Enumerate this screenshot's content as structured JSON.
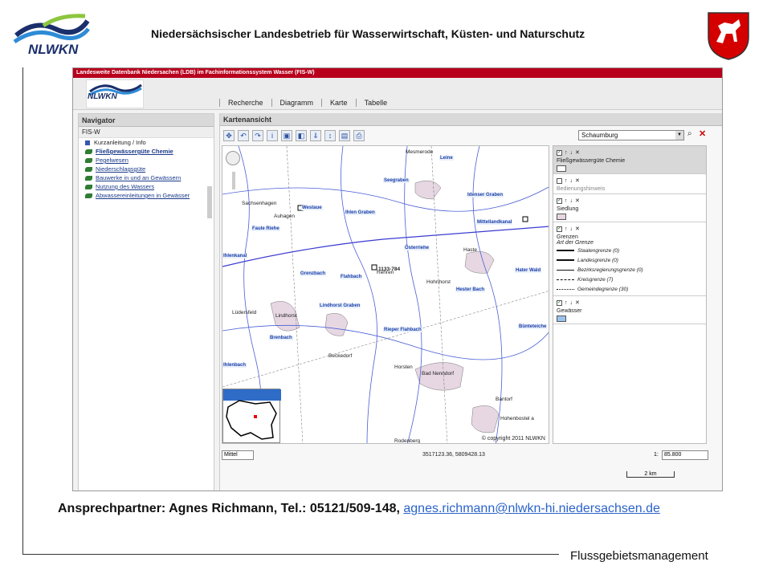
{
  "slide": {
    "title": "Niedersächsischer Landesbetrieb für Wasserwirtschaft, Küsten- und Naturschutz",
    "logo_text": "NLWKN",
    "contact_label": "Ansprechpartner: Agnes Richmann, Tel.: 05121/509-148, ",
    "contact_email": "agnes.richmann@nlwkn-hi.niedersachsen.de",
    "footer": "Flussgebietsmanagement"
  },
  "app": {
    "title_bar": "Landesweite Datenbank Niedersachen (LDB) im Fachinformationssystem Wasser (FIS-W)",
    "logo_text": "NLWKN",
    "menu": [
      "Recherche",
      "Diagramm",
      "Karte",
      "Tabelle"
    ],
    "navigator": {
      "title": "Navigator",
      "root": "FIS-W",
      "items": [
        "Kurzanleitung / Info",
        "Fließgewässergüte Chemie",
        "Pegelwesen",
        "Niederschlagsgüte",
        "Bauwerke in und an Gewässern",
        "Nutzung des Wassers",
        "Abwassereinleitungen in Gewässer"
      ]
    },
    "map_panel": {
      "title": "Kartenansicht",
      "region_select": "Schaumburg",
      "copyright": "© copyright 2011 NLWKN",
      "zoom_level": "Mittel",
      "coords": "3517123.36, 5809428.13",
      "scale_prefix": "1:",
      "scale_value": "85.800",
      "scalebar_label": "2 km"
    },
    "map_labels": {
      "places": [
        "Mesmerode",
        "Sachsenhagen",
        "Auhagen",
        "Haste",
        "Rehren",
        "Hohnhorst",
        "Lüdersfeld",
        "Lindhorst",
        "Beckedorf",
        "Horsten",
        "Bad Nenndorf",
        "Bantorf",
        "Hohenbostel a",
        "Rodenberg"
      ],
      "waters": [
        "Leine",
        "Seegraben",
        "Westaue",
        "Ihlen Graben",
        "Idenser Graben",
        "Mittellandkanal",
        "Faule Riehe",
        "Österriehe",
        "Grenzbach",
        "Flahbach",
        "Lindhorst Graben",
        "Hester Bach",
        "Rieper Flahbach",
        "Brenbach",
        "Bünteteiche",
        "Hater Wald",
        "Ihlenbach",
        "Ihlenkanal"
      ],
      "station": "1133-784"
    },
    "legend": {
      "layers": [
        {
          "name": "Fließgewässergüte Chemie",
          "selected": true
        },
        {
          "name": "Bedienungshinweis",
          "selected": false
        },
        {
          "name": "Siedlung",
          "selected": false
        },
        {
          "name": "Grenzen",
          "selected": false
        },
        {
          "name": "Gewässer",
          "selected": false
        }
      ],
      "grenzen_sub": "Art der Grenze",
      "grenzen_entries": [
        "Staatengrenze (0)",
        "Landesgrenze (0)",
        "Bezirksregierungsgrenze (0)",
        "Kreisgrenze (7)",
        "Gemeindegrenze (30)"
      ]
    }
  },
  "colors": {
    "title_bar": "#b8001c",
    "water_label": "#1e3fa8",
    "settlement": "#e6d7e3",
    "water_swatch": "#9cc3ec",
    "email_link": "#2b63c9"
  }
}
